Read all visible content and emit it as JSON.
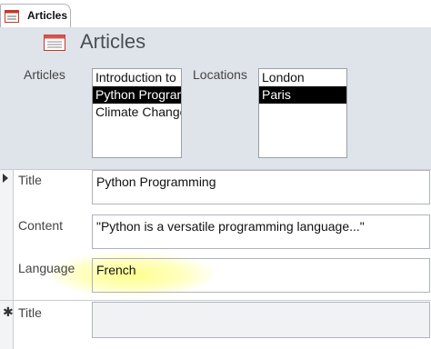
{
  "tab": {
    "label": "Articles"
  },
  "header": {
    "title": "Articles"
  },
  "articles": {
    "label": "Articles",
    "items": [
      {
        "text": "Introduction to"
      },
      {
        "text": "Python Program"
      },
      {
        "text": "Climate Change"
      }
    ],
    "selected_index": 1
  },
  "locations": {
    "label": "Locations",
    "items": [
      {
        "text": "London"
      },
      {
        "text": "Paris"
      }
    ],
    "selected_index": 1
  },
  "record": {
    "title_label": "Title",
    "title_value": "Python Programming",
    "content_label": "Content",
    "content_value": "\"Python is a versatile programming language...\"",
    "language_label": "Language",
    "language_value": "French"
  },
  "new_record": {
    "title_label": "Title",
    "title_value": ""
  },
  "icons": {
    "tab": "form-icon",
    "header": "form-icon",
    "current_record": "record-selector-arrow-icon",
    "new_record": "new-record-star-icon"
  },
  "colors": {
    "header_bg": "#dfe3ea",
    "selected_bg": "#000000",
    "highlight": "#ffff80"
  }
}
